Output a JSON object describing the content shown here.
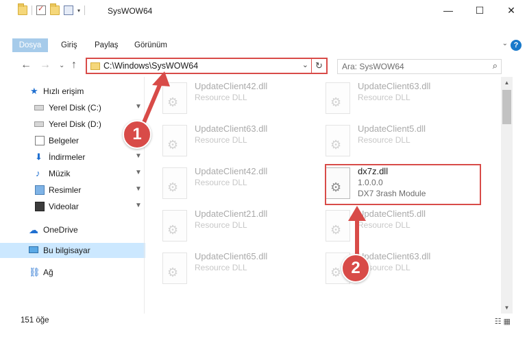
{
  "window": {
    "title": "SysWOW64",
    "minimize": "—",
    "maximize": "☐",
    "close": "✕"
  },
  "ribbon": {
    "file_tab": "Dosya",
    "tabs": [
      "Giriş",
      "Paylaş",
      "Görünüm"
    ],
    "expand": "⌄",
    "help": "?"
  },
  "nav": {
    "back": "←",
    "forward": "→",
    "recent": "⌄",
    "up": "↑",
    "address": "C:\\Windows\\SysWOW64",
    "address_dropdown": "⌄",
    "refresh": "↻",
    "search_placeholder": "Ara: SysWOW64",
    "search_icon": "⌕"
  },
  "sidebar": {
    "items": [
      {
        "label": "Hızlı erişim",
        "icon": "star-icon",
        "glyph": "★",
        "pinned": false
      },
      {
        "label": "Yerel Disk (C:)",
        "icon": "disk-icon",
        "glyph": "",
        "pinned": true
      },
      {
        "label": "Yerel Disk (D:)",
        "icon": "disk-icon",
        "glyph": "",
        "pinned": true
      },
      {
        "label": "Belgeler",
        "icon": "document-icon",
        "glyph": "",
        "pinned": true
      },
      {
        "label": "İndirmeler",
        "icon": "download-icon",
        "glyph": "⬇",
        "pinned": true
      },
      {
        "label": "Müzik",
        "icon": "music-icon",
        "glyph": "♪",
        "pinned": true
      },
      {
        "label": "Resimler",
        "icon": "pictures-icon",
        "glyph": "",
        "pinned": true
      },
      {
        "label": "Videolar",
        "icon": "video-icon",
        "glyph": "",
        "pinned": true
      },
      {
        "label": "OneDrive",
        "icon": "cloud-icon",
        "glyph": "☁",
        "pinned": false
      },
      {
        "label": "Bu bilgisayar",
        "icon": "computer-icon",
        "glyph": "",
        "pinned": false
      },
      {
        "label": "Ağ",
        "icon": "network-icon",
        "glyph": "⛓",
        "pinned": false
      }
    ],
    "pin_glyph": "📌"
  },
  "files": [
    {
      "name": "UpdateClient42.dll",
      "type": "Resource DLL",
      "extra": ""
    },
    {
      "name": "UpdateClient63.dll",
      "type": "Resource DLL",
      "extra": ""
    },
    {
      "name": "UpdateClient63.dll",
      "type": "Resource DLL",
      "extra": ""
    },
    {
      "name": "UpdateClient5.dll",
      "type": "Resource DLL",
      "extra": ""
    },
    {
      "name": "UpdateClient42.dll",
      "type": "Resource DLL",
      "extra": ""
    },
    {
      "name": "dx7z.dll",
      "type": "1.0.0.0",
      "extra": "DX7 3rash Module"
    },
    {
      "name": "UpdateClient21.dll",
      "type": "Resource DLL",
      "extra": ""
    },
    {
      "name": "UpdateClient5.dll",
      "type": "Resource DLL",
      "extra": ""
    },
    {
      "name": "UpdateClient65.dll",
      "type": "Resource DLL",
      "extra": ""
    },
    {
      "name": "UpdateClient63.dll",
      "type": "Resource DLL",
      "extra": ""
    }
  ],
  "status": {
    "count": "151 öğe",
    "views": "☷ ▦"
  },
  "annotations": {
    "step1": "1",
    "step2": "2",
    "color": "#d84b48"
  },
  "scrollbar": {
    "up": "▲",
    "down": "▼"
  }
}
